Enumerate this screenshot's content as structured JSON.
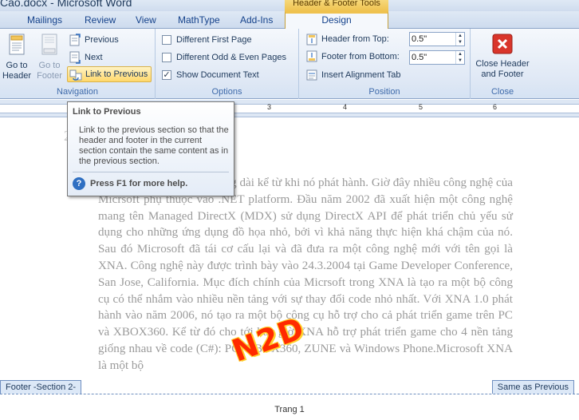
{
  "window": {
    "title": "Cao.docx - Microsoft Word",
    "context_tab_label": "Header & Footer Tools"
  },
  "tabs": {
    "items": [
      "Mailings",
      "Review",
      "View",
      "MathType",
      "Add-Ins"
    ],
    "active": "Design"
  },
  "ribbon": {
    "navigation": {
      "label": "Navigation",
      "go_to_header": "Go to Header",
      "go_to_footer": "Go to Footer",
      "previous": "Previous",
      "next": "Next",
      "link_to_previous": "Link to Previous"
    },
    "options": {
      "label": "Options",
      "different_first_page": "Different First Page",
      "different_odd_even": "Different Odd & Even Pages",
      "show_document_text": "Show Document Text",
      "different_first_page_checked": false,
      "different_odd_even_checked": false,
      "show_document_text_checked": true
    },
    "position": {
      "label": "Position",
      "header_from_top_label": "Header from Top:",
      "header_from_top_value": "0.5\"",
      "footer_from_bottom_label": "Footer from Bottom:",
      "footer_from_bottom_value": "0.5\"",
      "insert_alignment_tab": "Insert Alignment Tab"
    },
    "close": {
      "label": "Close",
      "close_header_footer": "Close Header and Footer"
    }
  },
  "tooltip": {
    "title": "Link to Previous",
    "description": "Link to the previous section so that the header and footer in the current section contain the same content as in the previous section.",
    "help": "Press F1 for more help."
  },
  "document": {
    "partial_heading": "2",
    "body": "đã trải qua một chặng đường dài kể từ khi nó phát hành. Giờ đây nhiều công nghệ của Micrsoft phụ thuộc vào .NET platform. Đầu năm 2002 đã xuất hiện một công nghệ mang tên Managed DirectX (MDX) sử dụng DirectX API để phát triển chủ yếu sử dụng cho những ứng dụng đồ họa nhỏ, bởi vì khả năng thực hiện khá chậm của nó. Sau đó Microsoft đã tái cơ cấu lại và đã đưa ra một công nghệ mới với tên gọi là XNA. Công nghệ này được trình bày vào 24.3.2004 tại Game Developer Conference, San Jose, California. Mục đích chính của Micrsoft trong XNA là tạo ra một bộ công cụ có thể nhắm vào nhiều nền tảng với sự thay đổi code nhỏ nhất. Với XNA 1.0 phát hành vào năm 2006, nó tạo ra một bộ công cụ hỗ trợ cho cả phát triển game trên PC và XBOX360. Kể từ đó cho tới bây giờ XNA hỗ trợ phát triển game cho 4 nền tảng giống nhau về code (C#): PC, XBOX360, ZUNE và Windows Phone.Microsoft XNA là một bộ",
    "watermark": "N2D",
    "footer_section_label": "Footer -Section 2-",
    "same_as_previous": "Same as Previous",
    "footer_page_text": "Trang 1"
  },
  "ruler": {
    "numbers": [
      "1",
      "2",
      "3",
      "4",
      "5",
      "6"
    ]
  },
  "colors": {
    "accent": "#15428b",
    "context_tab": "#efc24f",
    "highlight": "#ffd86b",
    "watermark": "#ff2a00",
    "close_icon": "#d9352b"
  }
}
